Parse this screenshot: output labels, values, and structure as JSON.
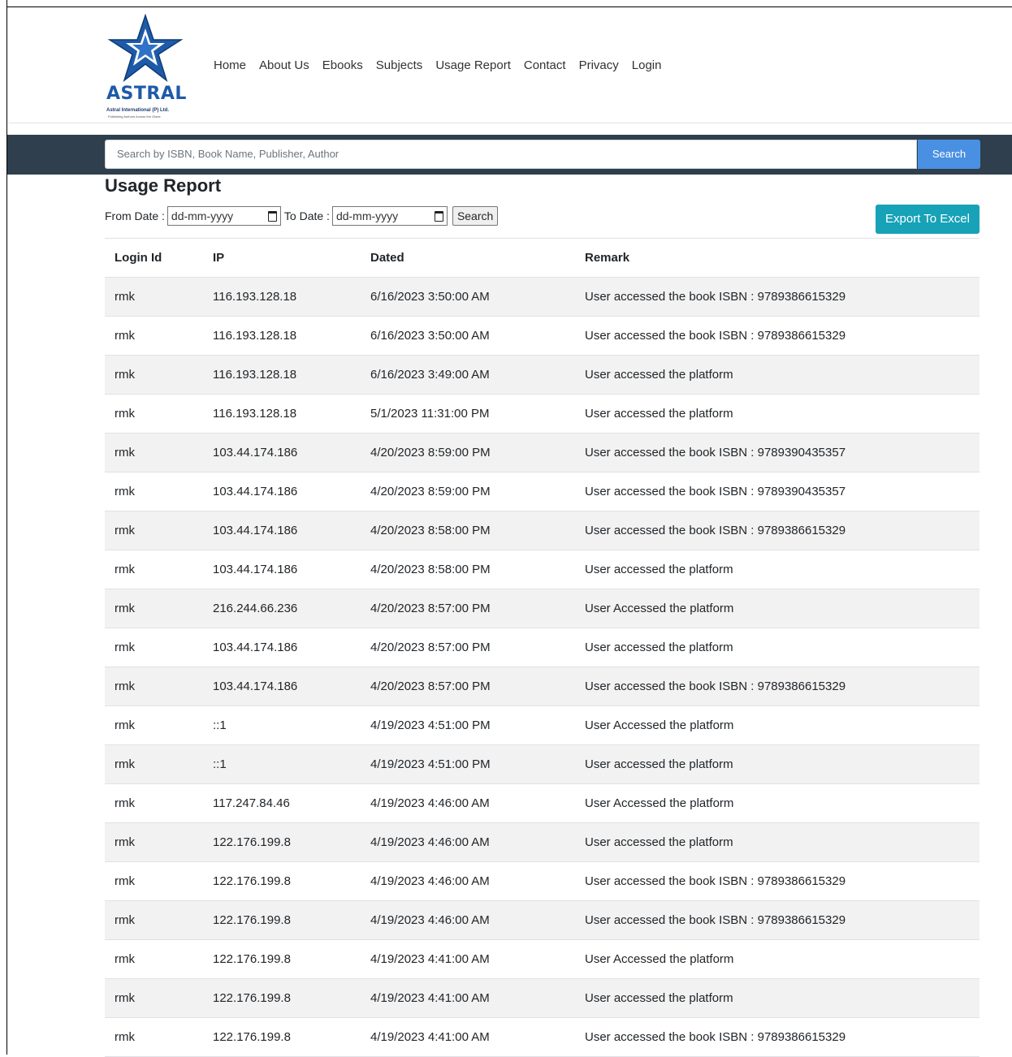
{
  "header": {
    "logo": {
      "wordmark": "ASTRAL",
      "company": "Astral International (P) Ltd.",
      "tagline": "Publishing Authors Across the Globe"
    },
    "nav": [
      "Home",
      "About Us",
      "Ebooks",
      "Subjects",
      "Usage Report",
      "Contact",
      "Privacy",
      "Login"
    ]
  },
  "search": {
    "placeholder": "Search by ISBN, Book Name, Publisher, Author",
    "button_label": "Search"
  },
  "page": {
    "title": "Usage Report",
    "from_label": "From Date :",
    "to_label": "To Date :",
    "date_placeholder": "dd-mm-yyyy",
    "filter_button": "Search",
    "export_button": "Export To Excel"
  },
  "table": {
    "headers": [
      "Login Id",
      "IP",
      "Dated",
      "Remark"
    ],
    "rows": [
      [
        "rmk",
        "116.193.128.18",
        "6/16/2023 3:50:00 AM",
        "User accessed the book ISBN : 9789386615329"
      ],
      [
        "rmk",
        "116.193.128.18",
        "6/16/2023 3:50:00 AM",
        "User accessed the book ISBN : 9789386615329"
      ],
      [
        "rmk",
        "116.193.128.18",
        "6/16/2023 3:49:00 AM",
        "User accessed the platform"
      ],
      [
        "rmk",
        "116.193.128.18",
        "5/1/2023 11:31:00 PM",
        "User accessed the platform"
      ],
      [
        "rmk",
        "103.44.174.186",
        "4/20/2023 8:59:00 PM",
        "User accessed the book ISBN : 9789390435357"
      ],
      [
        "rmk",
        "103.44.174.186",
        "4/20/2023 8:59:00 PM",
        "User accessed the book ISBN : 9789390435357"
      ],
      [
        "rmk",
        "103.44.174.186",
        "4/20/2023 8:58:00 PM",
        "User accessed the book ISBN : 9789386615329"
      ],
      [
        "rmk",
        "103.44.174.186",
        "4/20/2023 8:58:00 PM",
        "User accessed the platform"
      ],
      [
        "rmk",
        "216.244.66.236",
        "4/20/2023 8:57:00 PM",
        "User Accessed the platform"
      ],
      [
        "rmk",
        "103.44.174.186",
        "4/20/2023 8:57:00 PM",
        "User accessed the platform"
      ],
      [
        "rmk",
        "103.44.174.186",
        "4/20/2023 8:57:00 PM",
        "User accessed the book ISBN : 9789386615329"
      ],
      [
        "rmk",
        "::1",
        "4/19/2023 4:51:00 PM",
        "User Accessed the platform"
      ],
      [
        "rmk",
        "::1",
        "4/19/2023 4:51:00 PM",
        "User accessed the platform"
      ],
      [
        "rmk",
        "117.247.84.46",
        "4/19/2023 4:46:00 AM",
        "User Accessed the platform"
      ],
      [
        "rmk",
        "122.176.199.8",
        "4/19/2023 4:46:00 AM",
        "User accessed the platform"
      ],
      [
        "rmk",
        "122.176.199.8",
        "4/19/2023 4:46:00 AM",
        "User accessed the book ISBN : 9789386615329"
      ],
      [
        "rmk",
        "122.176.199.8",
        "4/19/2023 4:46:00 AM",
        "User accessed the book ISBN : 9789386615329"
      ],
      [
        "rmk",
        "122.176.199.8",
        "4/19/2023 4:41:00 AM",
        "User Accessed the platform"
      ],
      [
        "rmk",
        "122.176.199.8",
        "4/19/2023 4:41:00 AM",
        "User accessed the platform"
      ],
      [
        "rmk",
        "122.176.199.8",
        "4/19/2023 4:41:00 AM",
        "User accessed the book ISBN : 9789386615329"
      ]
    ]
  },
  "colors": {
    "search_band": "#2f3f4e",
    "search_button": "#4a90e2",
    "export_button": "#17a2b8",
    "stripe": "#f2f2f2",
    "logo_blue": "#1e5aa8"
  }
}
